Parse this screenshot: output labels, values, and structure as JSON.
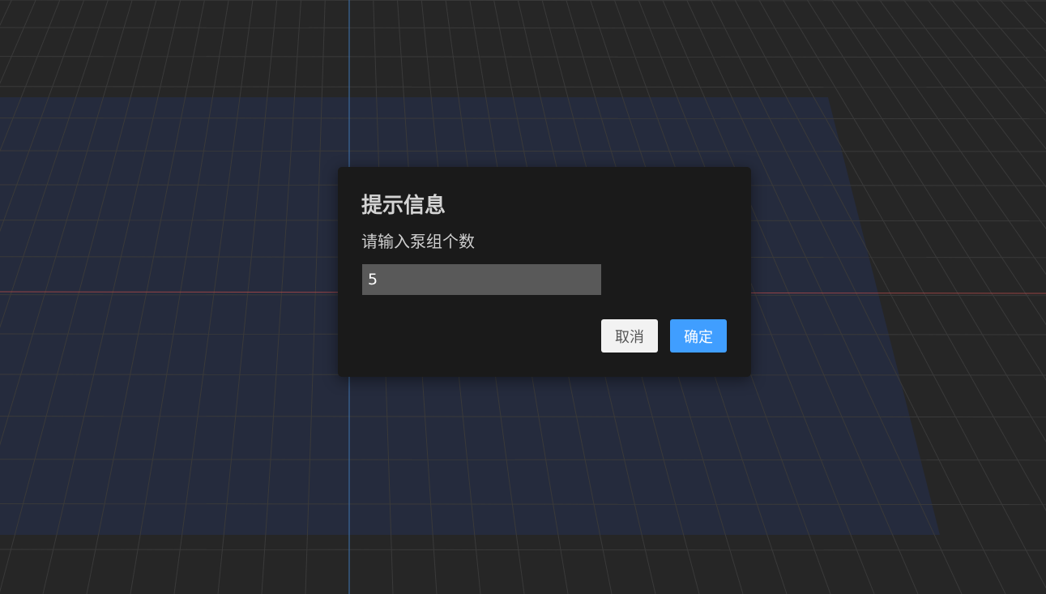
{
  "dialog": {
    "title": "提示信息",
    "message": "请输入泵组个数",
    "input_value": "5",
    "cancel_label": "取消",
    "confirm_label": "确定"
  },
  "colors": {
    "background": "#262626",
    "ground_plane": "#252b3d",
    "dialog_bg": "#1a1a1a",
    "input_bg": "#595959",
    "cancel_bg": "#f2f2f2",
    "confirm_bg": "#409eff",
    "axis_x": "#b04a4a",
    "axis_z": "#3d6fa8"
  }
}
